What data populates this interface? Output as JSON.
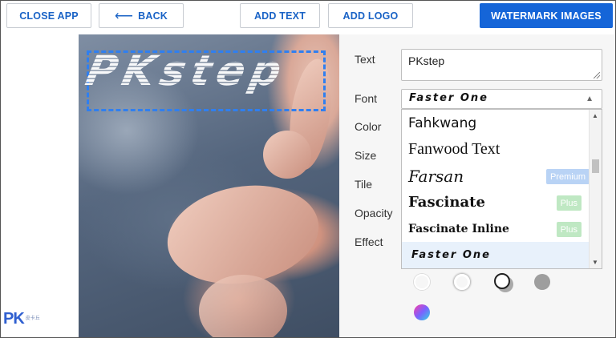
{
  "toolbar": {
    "close_app": "CLOSE APP",
    "back": "BACK",
    "add_text": "ADD TEXT",
    "add_logo": "ADD LOGO",
    "watermark_images": "WATERMARK IMAGES"
  },
  "watermark": {
    "text": "PKstep"
  },
  "logo": {
    "mark": "PK",
    "tagline": "皮卡丘"
  },
  "panel": {
    "labels": {
      "text": "Text",
      "font": "Font",
      "color": "Color",
      "size": "Size",
      "tile": "Tile",
      "opacity": "Opacity",
      "effect": "Effect"
    },
    "text_value": "PKstep",
    "font_selected": "Faster One",
    "font_options": [
      {
        "name": "Fahkwang",
        "badge": ""
      },
      {
        "name": "Fanwood Text",
        "badge": ""
      },
      {
        "name": "Farsan",
        "badge": "Premium"
      },
      {
        "name": "Fascinate",
        "badge": "Plus"
      },
      {
        "name": "Fascinate Inline",
        "badge": "Plus"
      },
      {
        "name": "Faster One",
        "badge": ""
      }
    ],
    "effect_swatches": [
      "#ffffff",
      "#ffffff",
      "#222222",
      "#9e9e9e",
      "#7b61ff"
    ]
  },
  "colors": {
    "accent": "#1565d8",
    "link": "#1a63c6",
    "selection": "#2f7ff0"
  }
}
